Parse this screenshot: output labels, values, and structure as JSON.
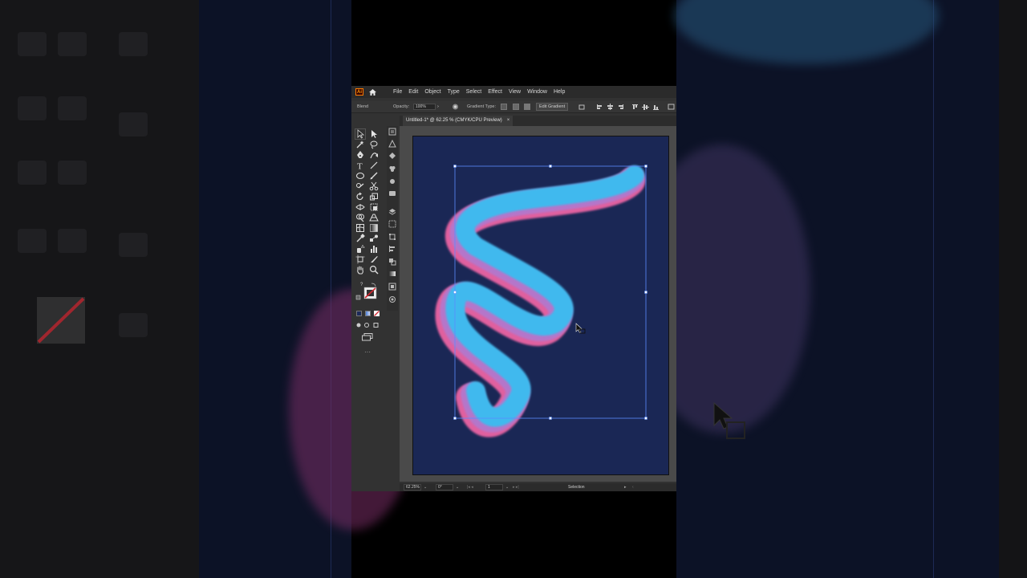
{
  "app": {
    "logo_text": "Ai",
    "menu": [
      "File",
      "Edit",
      "Object",
      "Type",
      "Select",
      "Effect",
      "View",
      "Window",
      "Help"
    ],
    "control_bar": {
      "blend_label": "Blend",
      "opacity_label": "Opacity:",
      "opacity_value": "100%",
      "gradient_type_label": "Gradient Type:",
      "edit_gradient_label": "Edit Gradient"
    },
    "document_tab": {
      "title": "Untitled-1* @ 62.25 % (CMYK/CPU Preview)",
      "close_glyph": "×"
    },
    "status_bar": {
      "zoom": "62.25%",
      "rotation": "0°",
      "artboard_number": "1",
      "tool_name": "Selection"
    },
    "colors": {
      "artboard_bg": "#1a2755",
      "gradient_pink": "#e6619f",
      "gradient_blue": "#3fb9ee",
      "selection_box": "#5b8cff",
      "ai_logo_border": "#ff7c00"
    },
    "toolbar_icons": [
      "selection-tool-icon",
      "direct-selection-tool-icon",
      "magic-wand-icon",
      "lasso-icon",
      "pen-tool-icon",
      "curvature-tool-icon",
      "type-tool-icon",
      "line-tool-icon",
      "ellipse-tool-icon",
      "paintbrush-icon",
      "shaper-tool-icon",
      "scissors-icon",
      "rotate-tool-icon",
      "scale-tool-icon",
      "width-tool-icon",
      "free-transform-icon",
      "shape-builder-icon",
      "perspective-grid-icon",
      "mesh-tool-icon",
      "gradient-tool-icon",
      "eyedropper-icon",
      "blend-tool-icon",
      "symbol-sprayer-icon",
      "column-graph-icon",
      "artboard-tool-icon",
      "slice-tool-icon",
      "hand-tool-icon",
      "zoom-tool-icon"
    ],
    "panel_icons": [
      "properties-panel-icon",
      "libraries-panel-icon",
      "color-panel-icon",
      "color-guide-icon",
      "swatches-panel-icon",
      "brushes-panel-icon",
      "symbols-panel-icon",
      "graphic-styles-icon",
      "layers-panel-icon",
      "artboards-panel-icon",
      "transform-panel-icon",
      "align-panel-icon",
      "pathfinder-panel-icon",
      "transparency-panel-icon",
      "gradient-panel-icon",
      "appearance-panel-icon"
    ]
  }
}
